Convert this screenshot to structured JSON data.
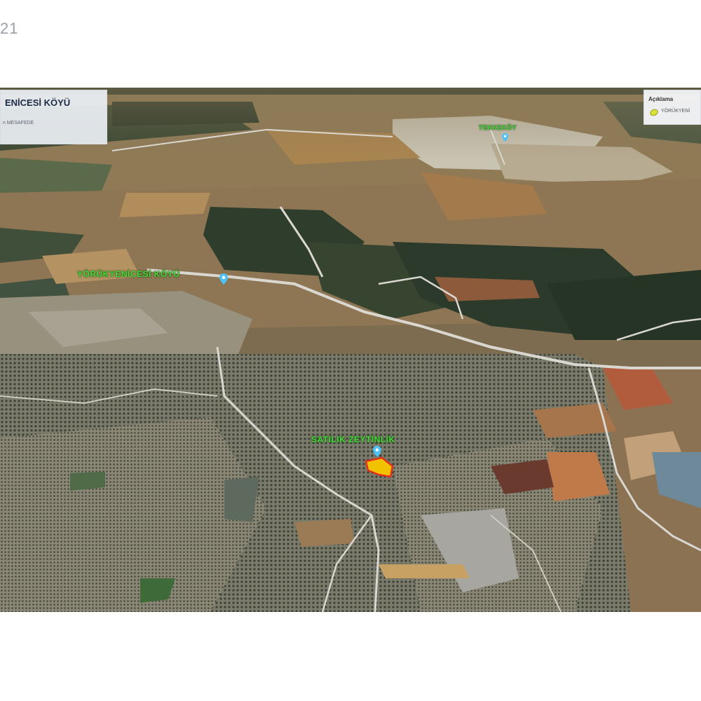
{
  "page": {
    "number": "21"
  },
  "info_box": {
    "title": "ENİCESİ KÖYÜ",
    "subtitle": "n MESAFEDE"
  },
  "legend": {
    "title": "Açıklama",
    "item_label": "YÖRÜKYENİ",
    "item_color": "#d8e23a"
  },
  "labels": {
    "village": "YÖRÜKYENİCESİ KÖYÜ",
    "parcel": "SATILIK ZEYTİNLİK",
    "top_place": "TEKKEKÖY"
  },
  "colors": {
    "label_green": "#4bdc3c",
    "pin_blue": "#4fc3f7",
    "parcel_fill": "#f2c200",
    "parcel_border": "#e0301e"
  },
  "icons": {
    "pin": "map-pin-icon"
  }
}
